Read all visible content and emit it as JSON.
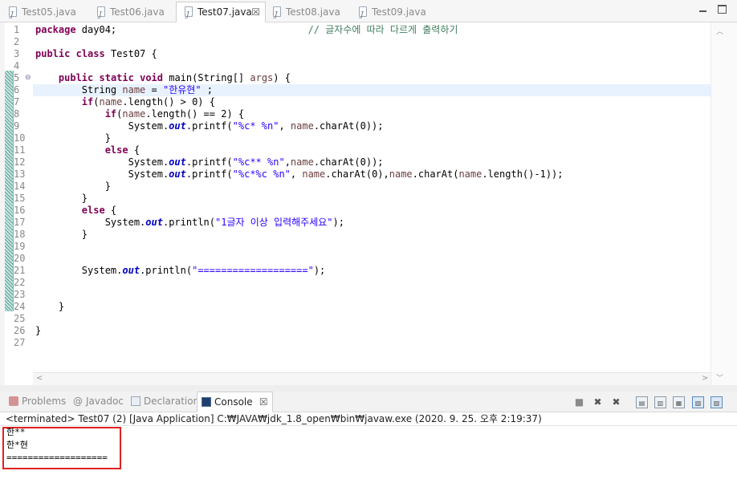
{
  "tabs": [
    {
      "label": "Test05.java",
      "icon": "java-file-icon"
    },
    {
      "label": "Test06.java",
      "icon": "java-file-icon"
    },
    {
      "label": "Test07.java",
      "icon": "java-file-icon",
      "active": true,
      "close": "☒"
    },
    {
      "label": "Test08.java",
      "icon": "java-file-icon"
    },
    {
      "label": "Test09.java",
      "icon": "java-file-icon"
    }
  ],
  "editor": {
    "current_line": 6,
    "fold_marker": "⊖",
    "lines": [
      {
        "num": "1",
        "tokens": [
          {
            "t": "keyword",
            "v": "package"
          },
          {
            "t": "plain",
            "v": " day04;                                 "
          },
          {
            "t": "comment",
            "v": "// 글자수에 따라 다르게 출력하기"
          }
        ]
      },
      {
        "num": "2",
        "tokens": []
      },
      {
        "num": "3",
        "tokens": [
          {
            "t": "keyword",
            "v": "public"
          },
          {
            "t": "plain",
            "v": " "
          },
          {
            "t": "keyword",
            "v": "class"
          },
          {
            "t": "plain",
            "v": " Test07 {"
          }
        ]
      },
      {
        "num": "4",
        "tokens": []
      },
      {
        "num": "5",
        "tokens": [
          {
            "t": "plain",
            "v": "    "
          },
          {
            "t": "keyword",
            "v": "public"
          },
          {
            "t": "plain",
            "v": " "
          },
          {
            "t": "keyword",
            "v": "static"
          },
          {
            "t": "plain",
            "v": " "
          },
          {
            "t": "keyword",
            "v": "void"
          },
          {
            "t": "plain",
            "v": " main(String[] "
          },
          {
            "t": "var",
            "v": "args"
          },
          {
            "t": "plain",
            "v": ") {"
          }
        ]
      },
      {
        "num": "6",
        "tokens": [
          {
            "t": "plain",
            "v": "        String "
          },
          {
            "t": "var",
            "v": "name"
          },
          {
            "t": "plain",
            "v": " = "
          },
          {
            "t": "string",
            "v": "\"한유현\""
          },
          {
            "t": "plain",
            "v": " ;"
          }
        ]
      },
      {
        "num": "7",
        "tokens": [
          {
            "t": "plain",
            "v": "        "
          },
          {
            "t": "keyword",
            "v": "if"
          },
          {
            "t": "plain",
            "v": "("
          },
          {
            "t": "var",
            "v": "name"
          },
          {
            "t": "plain",
            "v": ".length() > 0) {"
          }
        ]
      },
      {
        "num": "8",
        "tokens": [
          {
            "t": "plain",
            "v": "            "
          },
          {
            "t": "keyword",
            "v": "if"
          },
          {
            "t": "plain",
            "v": "("
          },
          {
            "t": "var",
            "v": "name"
          },
          {
            "t": "plain",
            "v": ".length() == 2) {"
          }
        ]
      },
      {
        "num": "9",
        "tokens": [
          {
            "t": "plain",
            "v": "                System."
          },
          {
            "t": "field",
            "v": "out"
          },
          {
            "t": "plain",
            "v": ".printf("
          },
          {
            "t": "string",
            "v": "\"%c* %n\""
          },
          {
            "t": "plain",
            "v": ", "
          },
          {
            "t": "var",
            "v": "name"
          },
          {
            "t": "plain",
            "v": ".charAt(0));"
          }
        ]
      },
      {
        "num": "10",
        "tokens": [
          {
            "t": "plain",
            "v": "            }"
          }
        ]
      },
      {
        "num": "11",
        "tokens": [
          {
            "t": "plain",
            "v": "            "
          },
          {
            "t": "keyword",
            "v": "else"
          },
          {
            "t": "plain",
            "v": " {"
          }
        ]
      },
      {
        "num": "12",
        "tokens": [
          {
            "t": "plain",
            "v": "                System."
          },
          {
            "t": "field",
            "v": "out"
          },
          {
            "t": "plain",
            "v": ".printf("
          },
          {
            "t": "string",
            "v": "\"%c** %n\""
          },
          {
            "t": "plain",
            "v": ","
          },
          {
            "t": "var",
            "v": "name"
          },
          {
            "t": "plain",
            "v": ".charAt(0));"
          }
        ]
      },
      {
        "num": "13",
        "tokens": [
          {
            "t": "plain",
            "v": "                System."
          },
          {
            "t": "field",
            "v": "out"
          },
          {
            "t": "plain",
            "v": ".printf("
          },
          {
            "t": "string",
            "v": "\"%c*%c %n\""
          },
          {
            "t": "plain",
            "v": ", "
          },
          {
            "t": "var",
            "v": "name"
          },
          {
            "t": "plain",
            "v": ".charAt(0),"
          },
          {
            "t": "var",
            "v": "name"
          },
          {
            "t": "plain",
            "v": ".charAt("
          },
          {
            "t": "var",
            "v": "name"
          },
          {
            "t": "plain",
            "v": ".length()-1));"
          }
        ]
      },
      {
        "num": "14",
        "tokens": [
          {
            "t": "plain",
            "v": "            }"
          }
        ]
      },
      {
        "num": "15",
        "tokens": [
          {
            "t": "plain",
            "v": "        }"
          }
        ]
      },
      {
        "num": "16",
        "tokens": [
          {
            "t": "plain",
            "v": "        "
          },
          {
            "t": "keyword",
            "v": "else"
          },
          {
            "t": "plain",
            "v": " {"
          }
        ]
      },
      {
        "num": "17",
        "tokens": [
          {
            "t": "plain",
            "v": "            System."
          },
          {
            "t": "field",
            "v": "out"
          },
          {
            "t": "plain",
            "v": ".println("
          },
          {
            "t": "string",
            "v": "\"1글자 이상 입력해주세요\""
          },
          {
            "t": "plain",
            "v": ");"
          }
        ]
      },
      {
        "num": "18",
        "tokens": [
          {
            "t": "plain",
            "v": "        }"
          }
        ]
      },
      {
        "num": "19",
        "tokens": []
      },
      {
        "num": "20",
        "tokens": []
      },
      {
        "num": "21",
        "tokens": [
          {
            "t": "plain",
            "v": "        System."
          },
          {
            "t": "field",
            "v": "out"
          },
          {
            "t": "plain",
            "v": ".println("
          },
          {
            "t": "string",
            "v": "\"===================\""
          },
          {
            "t": "plain",
            "v": ");"
          }
        ]
      },
      {
        "num": "22",
        "tokens": []
      },
      {
        "num": "23",
        "tokens": []
      },
      {
        "num": "24",
        "tokens": [
          {
            "t": "plain",
            "v": "    }"
          }
        ]
      },
      {
        "num": "25",
        "tokens": []
      },
      {
        "num": "26",
        "tokens": [
          {
            "t": "plain",
            "v": "}"
          }
        ]
      },
      {
        "num": "27",
        "tokens": []
      }
    ]
  },
  "views": {
    "tabs": [
      {
        "label": "Problems",
        "icon": "problems-icon"
      },
      {
        "label": "Javadoc",
        "icon": "javadoc-icon",
        "glyph": "@"
      },
      {
        "label": "Declaration",
        "icon": "declaration-icon"
      },
      {
        "label": "Console",
        "icon": "console-icon",
        "active": true,
        "close": "☒"
      }
    ],
    "toolbar": [
      {
        "name": "terminate-icon",
        "glyph": "■"
      },
      {
        "name": "remove-launch-icon",
        "glyph": "✖"
      },
      {
        "name": "remove-all-terminated-icon",
        "glyph": "✖"
      },
      {
        "name": "clear-console-icon",
        "glyph": "▤"
      },
      {
        "name": "scroll-lock-icon",
        "glyph": "▥"
      },
      {
        "name": "word-wrap-icon",
        "glyph": "▦"
      },
      {
        "name": "show-console-on-output-icon",
        "glyph": "▧"
      },
      {
        "name": "pin-console-icon",
        "glyph": "▨"
      },
      {
        "name": "display-selected-console-icon",
        "glyph": "▩"
      }
    ]
  },
  "console": {
    "header": "<terminated> Test07 (2) [Java Application] C:₩JAVA₩jdk_1.8_open₩bin₩javaw.exe (2020. 9. 25. 오후 2:19:37)",
    "output": [
      "한**",
      "한*현",
      "==================="
    ],
    "highlight_color": "#e02020"
  }
}
